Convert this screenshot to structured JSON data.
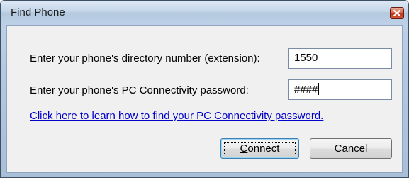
{
  "window": {
    "title": "Find Phone",
    "close_icon": "close-icon"
  },
  "form": {
    "directory_label": "Enter your phone's directory number (extension):",
    "directory_value": "1550",
    "password_label": "Enter your phone's PC Connectivity password:",
    "password_value": "####",
    "help_link": "Click here to learn how to find your PC Connectivity password."
  },
  "buttons": {
    "connect_accel": "C",
    "connect_rest": "onnect",
    "cancel": "Cancel"
  },
  "colors": {
    "close_button": "#c0391f",
    "link": "#0000cc",
    "default_button_border": "#3c7fb1"
  }
}
